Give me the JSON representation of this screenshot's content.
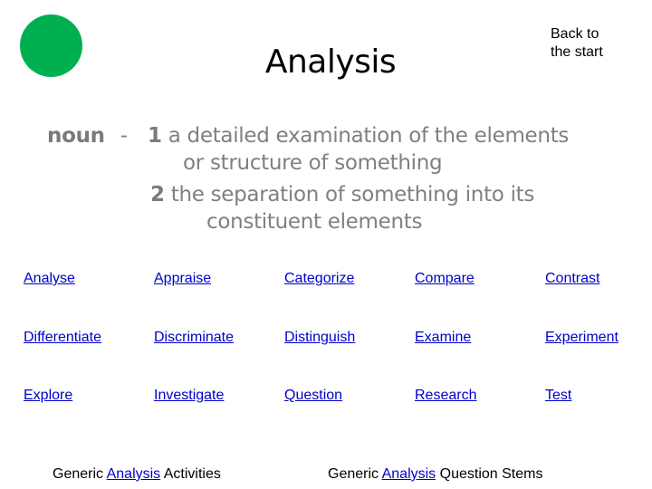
{
  "header": {
    "title": "Analysis",
    "back_link": [
      "Back to",
      "the start"
    ],
    "accent_color": "#00B050"
  },
  "definition": {
    "part_of_speech": "noun",
    "separator": "-",
    "senses": [
      {
        "number": "1",
        "lines": [
          "a detailed examination of the elements",
          "or structure of something"
        ]
      },
      {
        "number": "2",
        "lines": [
          "the separation of something into its",
          "constituent elements"
        ]
      }
    ]
  },
  "links": [
    [
      "Analyse",
      "Appraise",
      "Categorize",
      "Compare",
      "Contrast"
    ],
    [
      "Differentiate",
      "Discriminate",
      "Distinguish",
      "Examine",
      "Experiment"
    ],
    [
      "Explore",
      "Investigate",
      "Question",
      "Research",
      "Test"
    ]
  ],
  "footer": {
    "activities": {
      "prefix": "Generic",
      "link": "Analysis",
      "suffix": "Activities"
    },
    "question_stems": {
      "prefix": "Generic",
      "link": "Analysis",
      "suffix": "Question Stems"
    }
  }
}
